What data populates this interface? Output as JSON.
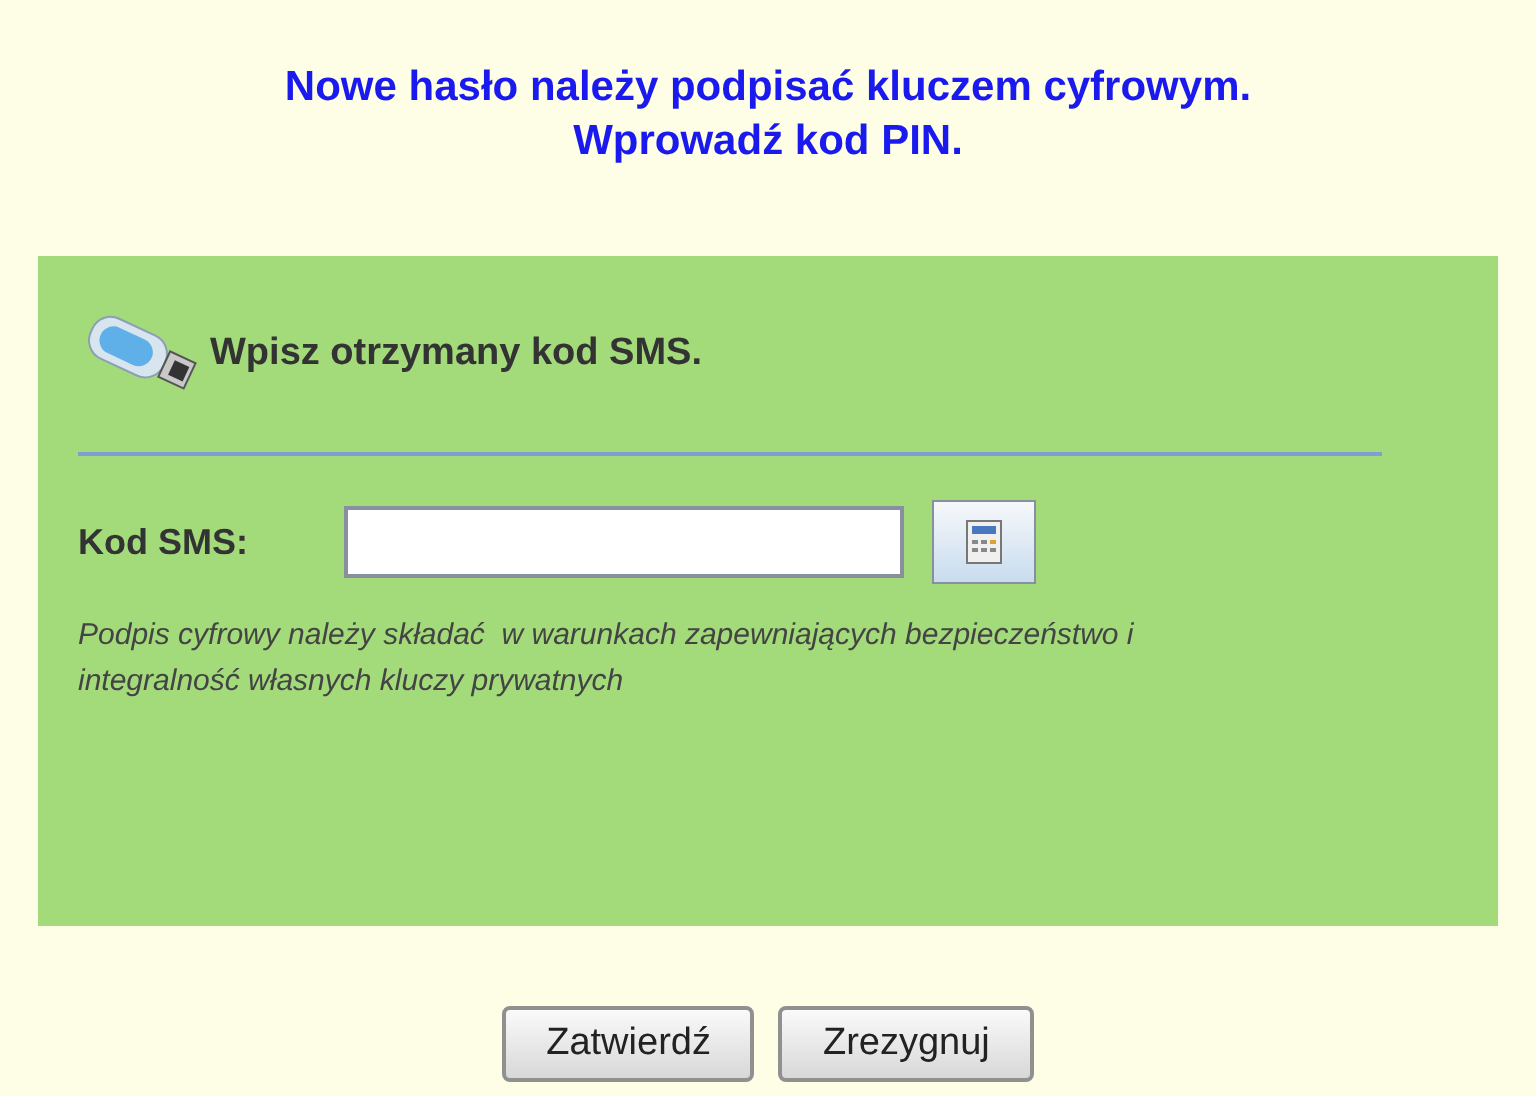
{
  "heading": [
    "Nowe hasło należy podpisać kluczem cyfrowym.",
    "Wprowadź kod PIN."
  ],
  "panel": {
    "title": "Wpisz otrzymany kod SMS.",
    "field_label": "Kod SMS:",
    "note": "Podpis cyfrowy należy składać  w warunkach zapewniających bezpieczeństwo i integralność własnych kluczy prywatnych"
  },
  "buttons": [
    "Zatwierdź",
    "Zrezygnuj"
  ]
}
